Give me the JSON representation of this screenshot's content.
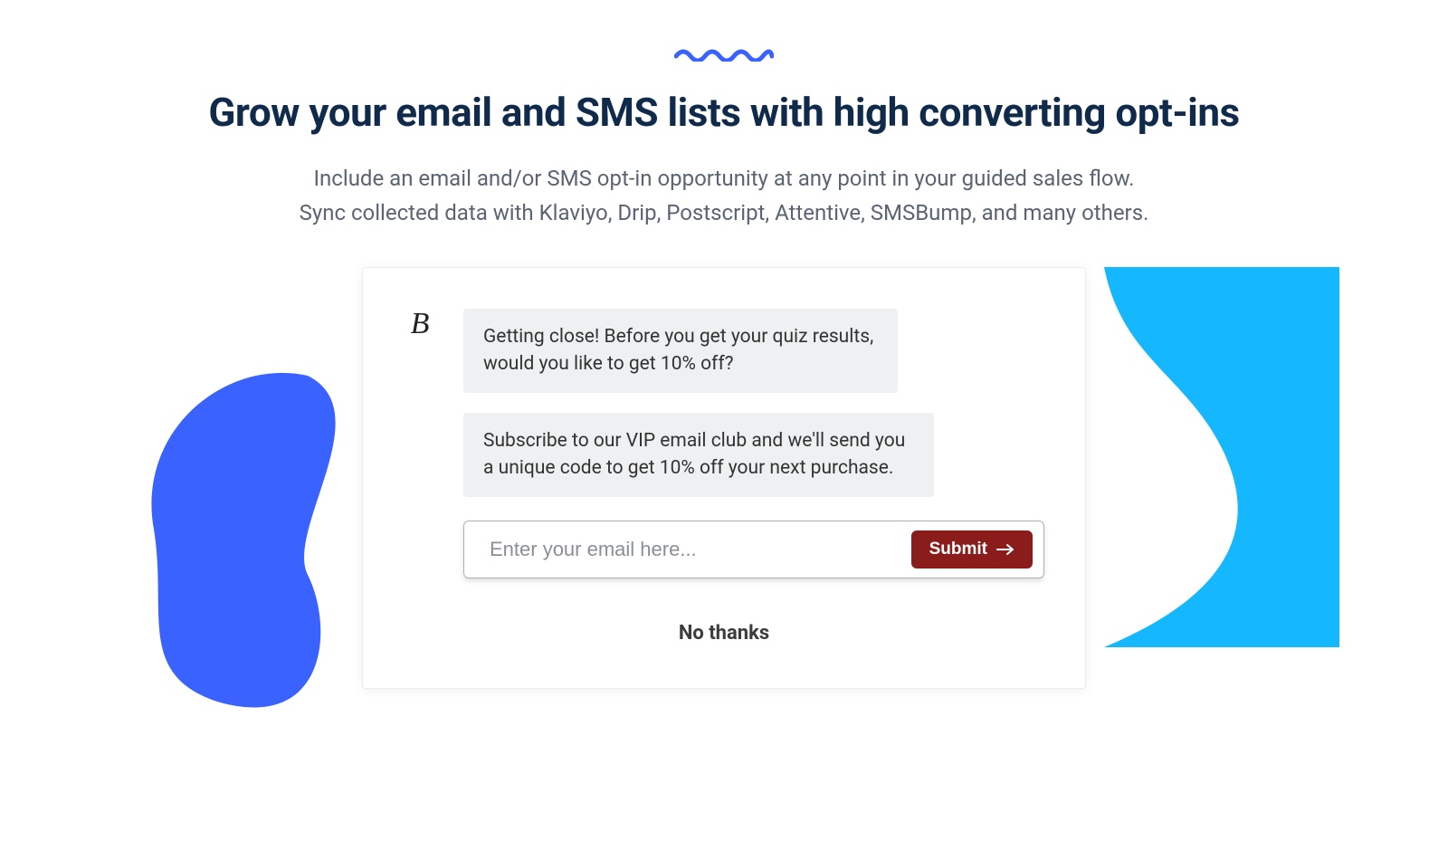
{
  "heading": "Grow your email and SMS lists with high converting opt-ins",
  "subtext_line1": "Include an email and/or SMS opt-in opportunity at any point in your guided sales flow.",
  "subtext_line2": "Sync collected data with Klaviyo, Drip, Postscript, Attentive, SMSBump, and many others.",
  "card": {
    "avatar_initial": "B",
    "bubble1": "Getting close! Before you get your quiz results, would you like to get 10% off?",
    "bubble2": "Subscribe to our VIP email club and we'll send you a unique code to get 10% off your next purchase.",
    "email_placeholder": "Enter your email here...",
    "submit_label": "Submit",
    "no_thanks_label": "No thanks"
  },
  "colors": {
    "accent_blue": "#3a62ff",
    "cyan": "#15b7ff",
    "submit_bg": "#8a1c1c"
  }
}
